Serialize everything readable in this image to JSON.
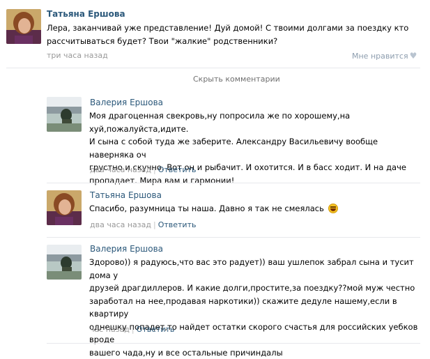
{
  "comments": [
    {
      "author": "Татьяна Ершова",
      "lines": [
        "Лера, заканчивай уже представление! Дуй домой! С твоими долгами за поездку кто",
        "рассчитываться будет? Твои \"жалкие\" родственники?"
      ],
      "time": "три часа назад",
      "like_label": "Мне нравится",
      "like_icon": "heart-icon"
    }
  ],
  "hide_comments_label": "Скрыть комментарии",
  "replies": [
    {
      "author": "Валерия Ершова",
      "lines": [
        "Моя драгоценная свекровь,ну попросила же по хорошему,на хуй,пожалуйста,идите.",
        "И сына с собой туда же заберите. Александру Васильевичу вообще наверняка оч",
        "грустно и скучно. Вот он и рыбачит. И охотится. И в басс ходит. И на даче",
        "пропадает. Мира вам и гармонии!"
      ],
      "time": "два часа назад",
      "reply_label": "Ответить"
    },
    {
      "author": "Татьяна Ершова",
      "lines": [
        "Спасибо, разумница ты наша. Давно я так не смеялась"
      ],
      "emoji": "laughing-emoji",
      "time": "два часа назад",
      "reply_label": "Ответить"
    },
    {
      "author": "Валерия Ершова",
      "lines": [
        "Здорово)) я радуюсь,что вас это радует)) ваш ушлепок забрал сына и тусит дома у",
        "друзей драгдиллеров. И какие долги,простите,за поездку??мой муж честно",
        "заработал на нее,продавая наркотики)) скажите дедуле нашему,если в квартиру",
        "однешку попадет,то найдет остатки скорого счастья для российских уебков вроде",
        "вашего чада,ну и все остальные причиндалы"
      ],
      "time": "час назад",
      "reply_label": "Ответить"
    }
  ],
  "colors": {
    "link": "#2b587a",
    "meta": "#999999",
    "divider": "#e7e8ec"
  }
}
